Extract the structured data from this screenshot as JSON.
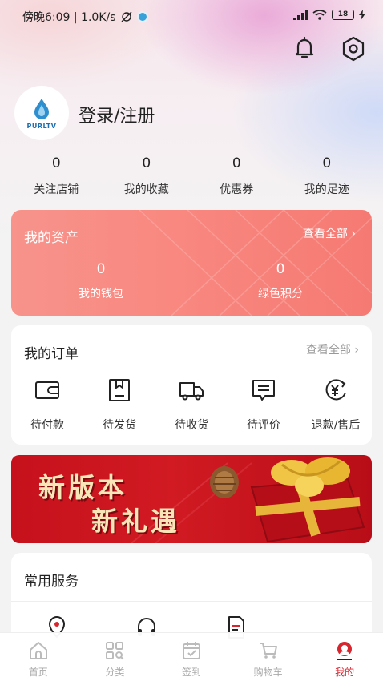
{
  "status_bar": {
    "time_text": "傍晚6:09 | 1.0K/s",
    "battery": "18"
  },
  "profile": {
    "logo_text": "PURLTV",
    "login_label": "登录/注册"
  },
  "stats": [
    {
      "value": "0",
      "label": "关注店铺"
    },
    {
      "value": "0",
      "label": "我的收藏"
    },
    {
      "value": "0",
      "label": "优惠券"
    },
    {
      "value": "0",
      "label": "我的足迹"
    }
  ],
  "assets": {
    "title": "我的资产",
    "view_all": "查看全部",
    "items": [
      {
        "value": "0",
        "label": "我的钱包"
      },
      {
        "value": "0",
        "label": "绿色积分"
      }
    ]
  },
  "orders": {
    "title": "我的订单",
    "view_all": "查看全部",
    "items": [
      {
        "label": "待付款",
        "icon": "wallet-icon"
      },
      {
        "label": "待发货",
        "icon": "box-icon"
      },
      {
        "label": "待收货",
        "icon": "truck-icon"
      },
      {
        "label": "待评价",
        "icon": "comment-icon"
      },
      {
        "label": "退款/售后",
        "icon": "refund-icon"
      }
    ]
  },
  "banner": {
    "line1": "新版本",
    "line2": "新礼遇"
  },
  "services": {
    "title": "常用服务",
    "icons": [
      "location-icon",
      "headset-icon",
      "document-icon"
    ]
  },
  "tabbar": [
    {
      "label": "首页",
      "icon": "home-icon",
      "active": false
    },
    {
      "label": "分类",
      "icon": "category-icon",
      "active": false
    },
    {
      "label": "签到",
      "icon": "calendar-icon",
      "active": false
    },
    {
      "label": "购物车",
      "icon": "cart-icon",
      "active": false
    },
    {
      "label": "我的",
      "icon": "profile-icon",
      "active": true
    }
  ],
  "colors": {
    "accent": "#d8262f",
    "assets_card": "#f8877f",
    "inactive_tab": "#aaaaaa"
  }
}
